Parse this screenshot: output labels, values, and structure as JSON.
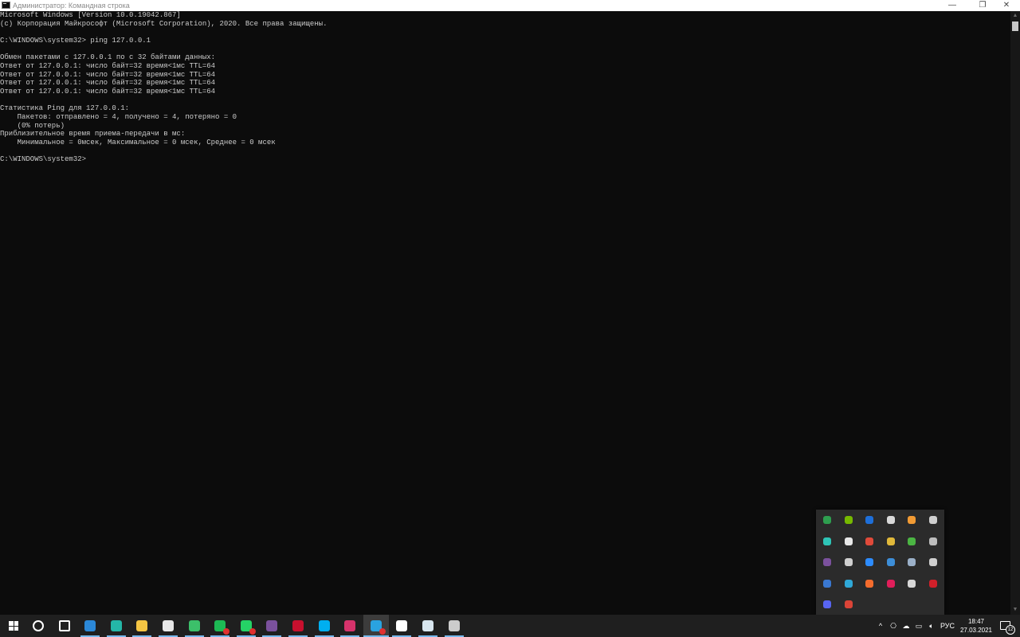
{
  "window": {
    "title": "Администратор: Командная строка",
    "controls": {
      "minimize": "—",
      "maximize": "❐",
      "close": "✕"
    }
  },
  "console": {
    "lines": [
      "Microsoft Windows [Version 10.0.19042.867]",
      "(с) Корпорация Майкрософт (Microsoft Corporation), 2020. Все права защищены.",
      "",
      "C:\\WINDOWS\\system32> ping 127.0.0.1",
      "",
      "Обмен пакетами с 127.0.0.1 по с 32 байтами данных:",
      "Ответ от 127.0.0.1: число байт=32 время<1мс TTL=64",
      "Ответ от 127.0.0.1: число байт=32 время<1мс TTL=64",
      "Ответ от 127.0.0.1: число байт=32 время<1мс TTL=64",
      "Ответ от 127.0.0.1: число байт=32 время<1мс TTL=64",
      "",
      "Статистика Ping для 127.0.0.1:",
      "    Пакетов: отправлено = 4, получено = 4, потеряно = 0",
      "    (0% потерь)",
      "Приблизительное время приема-передачи в мс:",
      "    Минимальное = 0мсек, Максимальное = 0 мсек, Среднее = 0 мсек",
      "",
      "C:\\WINDOWS\\system32>"
    ]
  },
  "scrollbar": {
    "up": "▲",
    "down": "▼"
  },
  "tray_popup": {
    "icons": [
      {
        "name": "shield-icon",
        "color": "#2e9e4f"
      },
      {
        "name": "nvidia-icon",
        "color": "#76b900"
      },
      {
        "name": "bluetooth-icon",
        "color": "#1e6fd9"
      },
      {
        "name": "security-shield-icon",
        "color": "#d8d8d8"
      },
      {
        "name": "sublime-icon",
        "color": "#f29b34"
      },
      {
        "name": "feather-icon",
        "color": "#cfcfcf"
      },
      {
        "name": "gyroscope-icon",
        "color": "#2ec4b6"
      },
      {
        "name": "crossed-circle-icon",
        "color": "#e8e8e8"
      },
      {
        "name": "bug-icon",
        "color": "#e04a3a"
      },
      {
        "name": "chrome-icon",
        "color": "#e0b83a"
      },
      {
        "name": "check-icon",
        "color": "#4bb543"
      },
      {
        "name": "network-drive-icon",
        "color": "#bdbdbd"
      },
      {
        "name": "viber-icon",
        "color": "#7b519d"
      },
      {
        "name": "clock-icon",
        "color": "#cfcfcf"
      },
      {
        "name": "zoom-icon",
        "color": "#2d8cff"
      },
      {
        "name": "steam-icon",
        "color": "#3d8ed8"
      },
      {
        "name": "camera-icon",
        "color": "#9bb0c8"
      },
      {
        "name": "monitor-icon",
        "color": "#cfcfcf"
      },
      {
        "name": "defender-icon",
        "color": "#3a78d1"
      },
      {
        "name": "quicktime-icon",
        "color": "#2fa8d8"
      },
      {
        "name": "origin-icon",
        "color": "#f56c2d"
      },
      {
        "name": "slack-icon",
        "color": "#e01e5a"
      },
      {
        "name": "mouse-icon",
        "color": "#d8d8d8"
      },
      {
        "name": "adobe-icon",
        "color": "#d0202a"
      },
      {
        "name": "discord-icon",
        "color": "#5865f2"
      },
      {
        "name": "chrome-alt-icon",
        "color": "#db4437"
      }
    ]
  },
  "taskbar": {
    "items": [
      {
        "name": "search-icon",
        "color": "#ffffff"
      },
      {
        "name": "task-view-icon",
        "color": "#ffffff"
      },
      {
        "name": "mail-icon",
        "color": "#2b88d8"
      },
      {
        "name": "edge-icon",
        "color": "#24b6a7"
      },
      {
        "name": "file-explorer-icon",
        "color": "#f3c443"
      },
      {
        "name": "store-icon",
        "color": "#e8e8e8"
      },
      {
        "name": "magnifier-app-icon",
        "color": "#3cc06a"
      },
      {
        "name": "kaspersky-icon",
        "color": "#1db954"
      },
      {
        "name": "whatsapp-icon",
        "color": "#25d366"
      },
      {
        "name": "viber-taskbar-icon",
        "color": "#7b519d"
      },
      {
        "name": "red-app-icon",
        "color": "#c8102e"
      },
      {
        "name": "skype-icon",
        "color": "#00aff0"
      },
      {
        "name": "music-app-icon",
        "color": "#d6336c"
      },
      {
        "name": "telegram-icon",
        "color": "#2aa3e0"
      },
      {
        "name": "vegas-icon",
        "color": "#ffffff"
      },
      {
        "name": "notepad-icon",
        "color": "#d8e6ef"
      },
      {
        "name": "command-prompt-icon",
        "color": "#cccccc"
      }
    ]
  },
  "system_tray": {
    "chevron": "^",
    "language": "РУС",
    "time": "18:47",
    "date": "27.03.2021",
    "notification_count": "12"
  }
}
